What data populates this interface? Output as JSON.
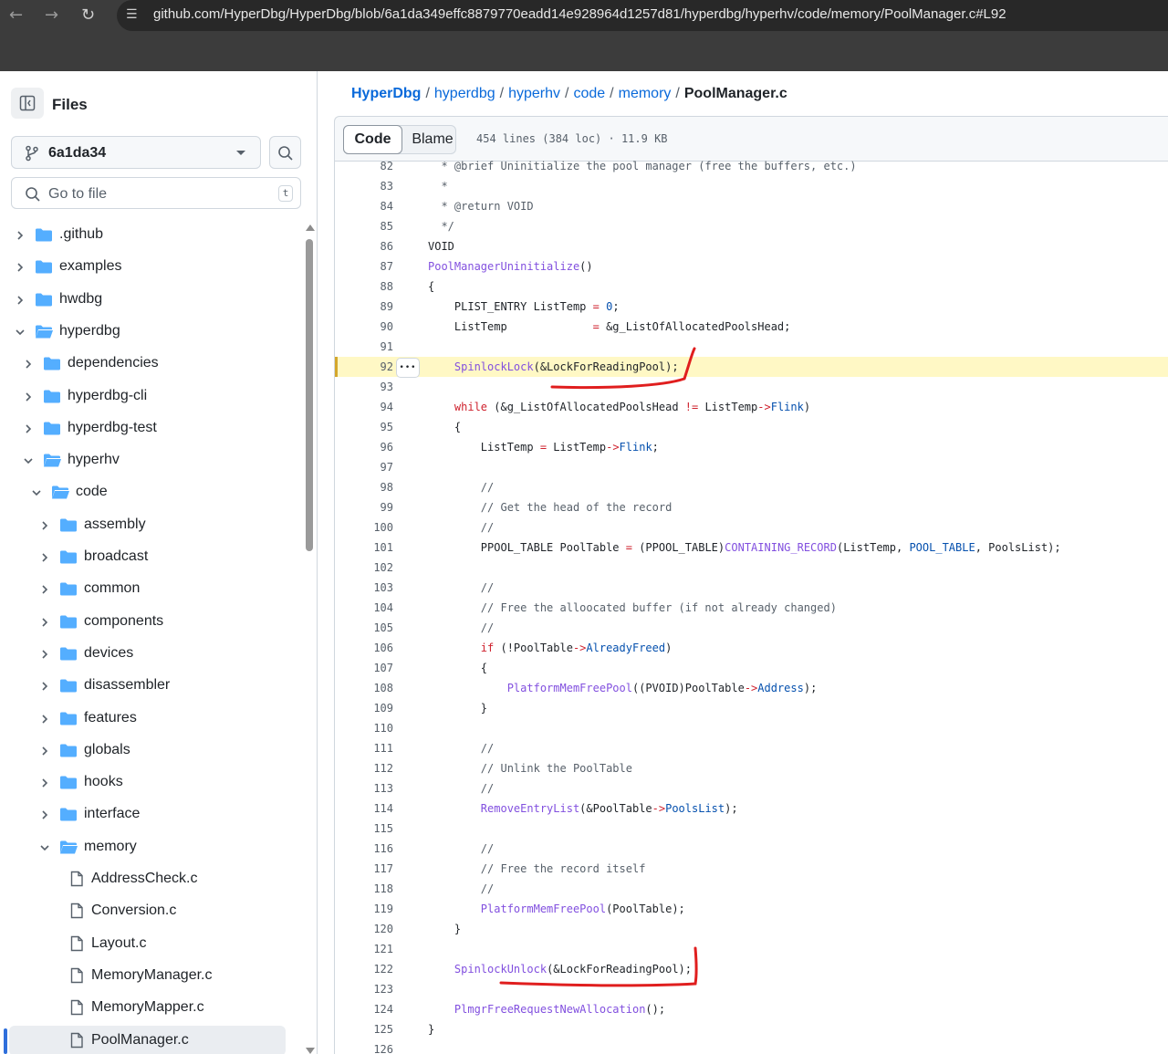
{
  "browser": {
    "url": "github.com/HyperDbg/HyperDbg/blob/6a1da349effc8879770eadd14e928964d1257d81/hyperdbg/hyperhv/code/memory/PoolManager.c#L92",
    "back_icon": "arrow-left-icon",
    "forward_icon": "arrow-right-icon",
    "reload_icon": "reload-icon"
  },
  "sidebar": {
    "title": "Files",
    "branch": "6a1da34",
    "search_placeholder": "Go to file",
    "search_shortcut": "t",
    "tree": [
      {
        "label": ".github",
        "type": "dir",
        "depth": 0,
        "expanded": false
      },
      {
        "label": "examples",
        "type": "dir",
        "depth": 0,
        "expanded": false
      },
      {
        "label": "hwdbg",
        "type": "dir",
        "depth": 0,
        "expanded": false
      },
      {
        "label": "hyperdbg",
        "type": "dir",
        "depth": 0,
        "expanded": true
      },
      {
        "label": "dependencies",
        "type": "dir",
        "depth": 1,
        "expanded": false
      },
      {
        "label": "hyperdbg-cli",
        "type": "dir",
        "depth": 1,
        "expanded": false
      },
      {
        "label": "hyperdbg-test",
        "type": "dir",
        "depth": 1,
        "expanded": false
      },
      {
        "label": "hyperhv",
        "type": "dir",
        "depth": 1,
        "expanded": true
      },
      {
        "label": "code",
        "type": "dir",
        "depth": 2,
        "expanded": true
      },
      {
        "label": "assembly",
        "type": "dir",
        "depth": 3,
        "expanded": false
      },
      {
        "label": "broadcast",
        "type": "dir",
        "depth": 3,
        "expanded": false
      },
      {
        "label": "common",
        "type": "dir",
        "depth": 3,
        "expanded": false
      },
      {
        "label": "components",
        "type": "dir",
        "depth": 3,
        "expanded": false
      },
      {
        "label": "devices",
        "type": "dir",
        "depth": 3,
        "expanded": false
      },
      {
        "label": "disassembler",
        "type": "dir",
        "depth": 3,
        "expanded": false
      },
      {
        "label": "features",
        "type": "dir",
        "depth": 3,
        "expanded": false
      },
      {
        "label": "globals",
        "type": "dir",
        "depth": 3,
        "expanded": false
      },
      {
        "label": "hooks",
        "type": "dir",
        "depth": 3,
        "expanded": false
      },
      {
        "label": "interface",
        "type": "dir",
        "depth": 3,
        "expanded": false
      },
      {
        "label": "memory",
        "type": "dir",
        "depth": 3,
        "expanded": true
      },
      {
        "label": "AddressCheck.c",
        "type": "file",
        "depth": 4
      },
      {
        "label": "Conversion.c",
        "type": "file",
        "depth": 4
      },
      {
        "label": "Layout.c",
        "type": "file",
        "depth": 4
      },
      {
        "label": "MemoryManager.c",
        "type": "file",
        "depth": 4
      },
      {
        "label": "MemoryMapper.c",
        "type": "file",
        "depth": 4
      },
      {
        "label": "PoolManager.c",
        "type": "file",
        "depth": 4,
        "selected": true
      }
    ]
  },
  "breadcrumb": [
    "HyperDbg",
    "hyperdbg",
    "hyperhv",
    "code",
    "memory"
  ],
  "breadcrumb_current": "PoolManager.c",
  "file": {
    "tab_code": "Code",
    "tab_blame": "Blame",
    "info": "454 lines (384 loc) · 11.9 KB",
    "highlighted_line": 92,
    "more_icon": "kebab-horizontal-icon",
    "lines": [
      {
        "n": "82",
        "code": [
          {
            "t": "c",
            "s": "  * @brief Uninitialize the pool manager (free the buffers, etc.)"
          }
        ]
      },
      {
        "n": "83",
        "code": [
          {
            "t": "c",
            "s": "  *"
          }
        ]
      },
      {
        "n": "84",
        "code": [
          {
            "t": "c",
            "s": "  * @return VOID"
          }
        ]
      },
      {
        "n": "85",
        "code": [
          {
            "t": "c",
            "s": "  */"
          }
        ]
      },
      {
        "n": "86",
        "code": [
          {
            "t": "",
            "s": "VOID"
          }
        ]
      },
      {
        "n": "87",
        "code": [
          {
            "t": "f",
            "s": "PoolManagerUninitialize"
          },
          {
            "t": "",
            "s": "()"
          }
        ]
      },
      {
        "n": "88",
        "code": [
          {
            "t": "",
            "s": "{"
          }
        ]
      },
      {
        "n": "89",
        "code": [
          {
            "t": "",
            "s": "    PLIST_ENTRY ListTemp "
          },
          {
            "t": "k",
            "s": "="
          },
          {
            "t": "",
            "s": " "
          },
          {
            "t": "m",
            "s": "0"
          },
          {
            "t": "",
            "s": ";"
          }
        ]
      },
      {
        "n": "90",
        "code": [
          {
            "t": "",
            "s": "    ListTemp             "
          },
          {
            "t": "k",
            "s": "="
          },
          {
            "t": "",
            "s": " &g_ListOfAllocatedPoolsHead;"
          }
        ]
      },
      {
        "n": "91",
        "code": []
      },
      {
        "n": "92",
        "code": [
          {
            "t": "",
            "s": "    "
          },
          {
            "t": "f",
            "s": "SpinlockLock"
          },
          {
            "t": "",
            "s": "(&LockForReadingPool);"
          }
        ]
      },
      {
        "n": "93",
        "code": []
      },
      {
        "n": "94",
        "code": [
          {
            "t": "",
            "s": "    "
          },
          {
            "t": "k",
            "s": "while"
          },
          {
            "t": "",
            "s": " (&g_ListOfAllocatedPoolsHead "
          },
          {
            "t": "k",
            "s": "!="
          },
          {
            "t": "",
            "s": " ListTemp"
          },
          {
            "t": "k",
            "s": "->"
          },
          {
            "t": "m",
            "s": "Flink"
          },
          {
            "t": "",
            "s": ")"
          }
        ]
      },
      {
        "n": "95",
        "code": [
          {
            "t": "",
            "s": "    {"
          }
        ]
      },
      {
        "n": "96",
        "code": [
          {
            "t": "",
            "s": "        ListTemp "
          },
          {
            "t": "k",
            "s": "="
          },
          {
            "t": "",
            "s": " ListTemp"
          },
          {
            "t": "k",
            "s": "->"
          },
          {
            "t": "m",
            "s": "Flink"
          },
          {
            "t": "",
            "s": ";"
          }
        ]
      },
      {
        "n": "97",
        "code": []
      },
      {
        "n": "98",
        "code": [
          {
            "t": "c",
            "s": "        //"
          }
        ]
      },
      {
        "n": "99",
        "code": [
          {
            "t": "c",
            "s": "        // Get the head of the record"
          }
        ]
      },
      {
        "n": "100",
        "code": [
          {
            "t": "c",
            "s": "        //"
          }
        ]
      },
      {
        "n": "101",
        "code": [
          {
            "t": "",
            "s": "        PPOOL_TABLE PoolTable "
          },
          {
            "t": "k",
            "s": "="
          },
          {
            "t": "",
            "s": " (PPOOL_TABLE)"
          },
          {
            "t": "f",
            "s": "CONTAINING_RECORD"
          },
          {
            "t": "",
            "s": "(ListTemp, "
          },
          {
            "t": "m",
            "s": "POOL_TABLE"
          },
          {
            "t": "",
            "s": ", PoolsList);"
          }
        ]
      },
      {
        "n": "102",
        "code": []
      },
      {
        "n": "103",
        "code": [
          {
            "t": "c",
            "s": "        //"
          }
        ]
      },
      {
        "n": "104",
        "code": [
          {
            "t": "c",
            "s": "        // Free the alloocated buffer (if not already changed)"
          }
        ]
      },
      {
        "n": "105",
        "code": [
          {
            "t": "c",
            "s": "        //"
          }
        ]
      },
      {
        "n": "106",
        "code": [
          {
            "t": "",
            "s": "        "
          },
          {
            "t": "k",
            "s": "if"
          },
          {
            "t": "",
            "s": " (!PoolTable"
          },
          {
            "t": "k",
            "s": "->"
          },
          {
            "t": "m",
            "s": "AlreadyFreed"
          },
          {
            "t": "",
            "s": ")"
          }
        ]
      },
      {
        "n": "107",
        "code": [
          {
            "t": "",
            "s": "        {"
          }
        ]
      },
      {
        "n": "108",
        "code": [
          {
            "t": "",
            "s": "            "
          },
          {
            "t": "f",
            "s": "PlatformMemFreePool"
          },
          {
            "t": "",
            "s": "((PVOID)PoolTable"
          },
          {
            "t": "k",
            "s": "->"
          },
          {
            "t": "m",
            "s": "Address"
          },
          {
            "t": "",
            "s": ");"
          }
        ]
      },
      {
        "n": "109",
        "code": [
          {
            "t": "",
            "s": "        }"
          }
        ]
      },
      {
        "n": "110",
        "code": []
      },
      {
        "n": "111",
        "code": [
          {
            "t": "c",
            "s": "        //"
          }
        ]
      },
      {
        "n": "112",
        "code": [
          {
            "t": "c",
            "s": "        // Unlink the PoolTable"
          }
        ]
      },
      {
        "n": "113",
        "code": [
          {
            "t": "c",
            "s": "        //"
          }
        ]
      },
      {
        "n": "114",
        "code": [
          {
            "t": "",
            "s": "        "
          },
          {
            "t": "f",
            "s": "RemoveEntryList"
          },
          {
            "t": "",
            "s": "(&PoolTable"
          },
          {
            "t": "k",
            "s": "->"
          },
          {
            "t": "m",
            "s": "PoolsList"
          },
          {
            "t": "",
            "s": ");"
          }
        ]
      },
      {
        "n": "115",
        "code": []
      },
      {
        "n": "116",
        "code": [
          {
            "t": "c",
            "s": "        //"
          }
        ]
      },
      {
        "n": "117",
        "code": [
          {
            "t": "c",
            "s": "        // Free the record itself"
          }
        ]
      },
      {
        "n": "118",
        "code": [
          {
            "t": "c",
            "s": "        //"
          }
        ]
      },
      {
        "n": "119",
        "code": [
          {
            "t": "",
            "s": "        "
          },
          {
            "t": "f",
            "s": "PlatformMemFreePool"
          },
          {
            "t": "",
            "s": "(PoolTable);"
          }
        ]
      },
      {
        "n": "120",
        "code": [
          {
            "t": "",
            "s": "    }"
          }
        ]
      },
      {
        "n": "121",
        "code": []
      },
      {
        "n": "122",
        "code": [
          {
            "t": "",
            "s": "    "
          },
          {
            "t": "f",
            "s": "SpinlockUnlock"
          },
          {
            "t": "",
            "s": "(&LockForReadingPool);"
          }
        ]
      },
      {
        "n": "123",
        "code": []
      },
      {
        "n": "124",
        "code": [
          {
            "t": "",
            "s": "    "
          },
          {
            "t": "f",
            "s": "PlmgrFreeRequestNewAllocation"
          },
          {
            "t": "",
            "s": "();"
          }
        ]
      },
      {
        "n": "125",
        "code": [
          {
            "t": "",
            "s": "}"
          }
        ]
      },
      {
        "n": "126",
        "code": []
      }
    ]
  },
  "colors": {
    "link": "#0969da",
    "annotation": "#e01e1e",
    "highlight": "#fff8c5",
    "folder": "#54aeff"
  }
}
